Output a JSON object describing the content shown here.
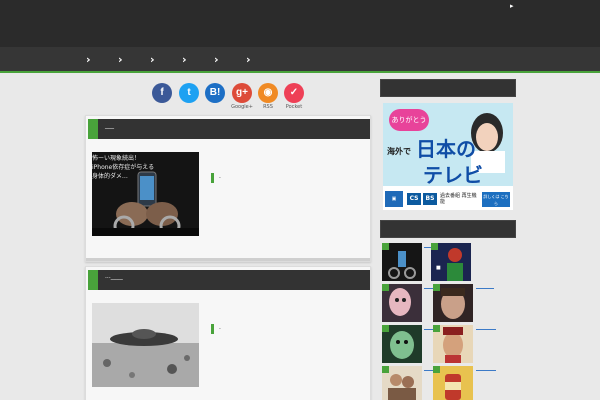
{
  "header": {
    "arrow_glyph": "▸"
  },
  "nav": {
    "items": [
      "›",
      "›",
      "›",
      "›",
      "›",
      "›"
    ]
  },
  "share": {
    "buttons": [
      {
        "label": "f",
        "caption": "",
        "color": "#3b5998",
        "icon": "facebook-icon"
      },
      {
        "label": "t",
        "caption": "",
        "color": "#1da1f2",
        "icon": "twitter-icon"
      },
      {
        "label": "B!",
        "caption": "",
        "color": "#1d6fc5",
        "icon": "hatena-bookmark-icon"
      },
      {
        "label": "g+",
        "caption": "Google+",
        "color": "#dd4b39",
        "icon": "google-plus-icon"
      },
      {
        "label": "◉",
        "caption": "RSS",
        "color": "#f08a24",
        "icon": "rss-icon"
      },
      {
        "label": "✓",
        "caption": "Pocket",
        "color": "#ee4056",
        "icon": "pocket-icon"
      }
    ]
  },
  "posts": [
    {
      "title": "___",
      "thumb_lines": [
        "怖ーい現象続出！",
        "iPhone依存症が与える",
        "身体的ダメ…"
      ],
      "read_more": "."
    },
    {
      "title": "...____",
      "thumb_lines": [],
      "read_more": "."
    }
  ],
  "ad": {
    "bubble": "ありがとう",
    "prefix": "海外で",
    "headline1": "日本の",
    "headline2": "テレビ",
    "badge_cs": "CS",
    "badge_bs": "BS",
    "caption": "過去番組 再生機能",
    "cta": "詳しくは こちら"
  },
  "sidebar": {
    "links": [
      "___________",
      "■ ■■■■■■■■■■■__",
      "___________",
      "_______",
      "__________",
      "________",
      "________",
      "_______"
    ]
  }
}
